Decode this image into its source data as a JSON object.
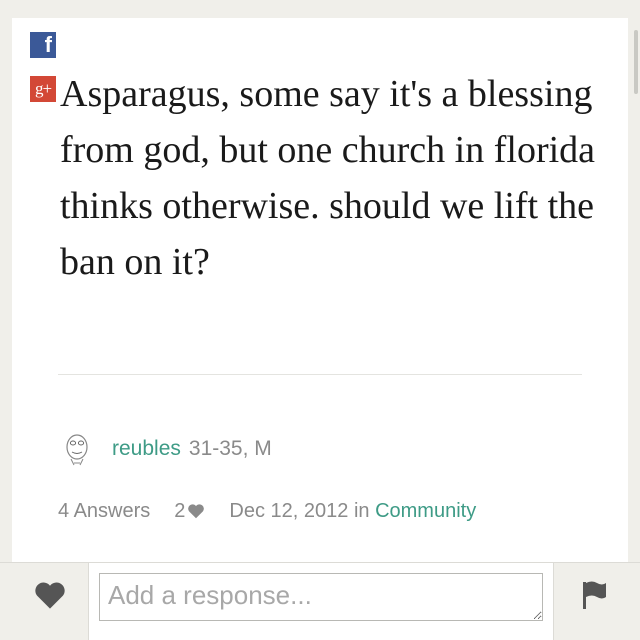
{
  "share": {
    "facebook_glyph": "f",
    "googleplus_glyph": "g+"
  },
  "question": {
    "text": "Asparagus, some say it's a blessing from god, but one church in florida thinks otherwise. should we lift the ban on it?"
  },
  "author": {
    "name": "reubles",
    "meta": "31-35, M"
  },
  "stats": {
    "answers": "4 Answers",
    "likes": "2",
    "date": "Dec 12, 2012",
    "in_word": "in",
    "category": "Community"
  },
  "response": {
    "placeholder": "Add a response..."
  },
  "icons": {
    "facebook": "facebook-icon",
    "googleplus": "googleplus-icon",
    "avatar": "rage-face-avatar",
    "heart": "heart-icon",
    "flag": "flag-icon"
  },
  "colors": {
    "facebook": "#3b5998",
    "googleplus": "#d34836",
    "accent": "#3e9b86",
    "muted": "#8a8a8a",
    "background": "#f0efea"
  }
}
